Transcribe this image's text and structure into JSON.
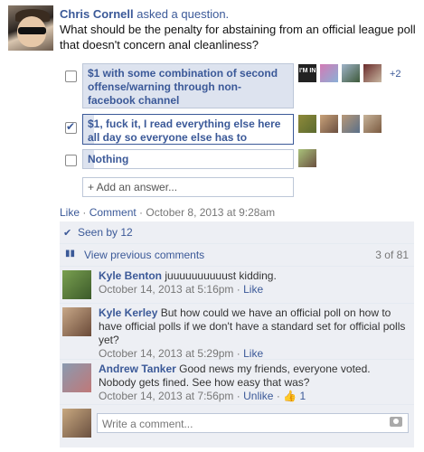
{
  "post": {
    "author": "Chris Cornell",
    "verb": "asked a question.",
    "question": "What should be the penalty for abstaining from an official league poll that doesn't concern anal cleanliness?"
  },
  "poll": {
    "options": [
      {
        "label": "$1 with some combination of second offense/warning through non-facebook channel",
        "checked": false,
        "fill": 1.0,
        "voters": [
          "avatar",
          "avatar",
          "avatar",
          "avatar"
        ],
        "more": "+2"
      },
      {
        "label": "$1, fuck it, I read everything else here all day so everyone else has to",
        "checked": true,
        "fill": 0.05,
        "voters": [
          "avatar",
          "avatar",
          "avatar",
          "avatar"
        ]
      },
      {
        "label": "Nothing",
        "checked": false,
        "fill": 0.05,
        "voters": [
          "avatar"
        ]
      }
    ],
    "add_answer": "+ Add an answer..."
  },
  "meta": {
    "like": "Like",
    "comment": "Comment",
    "date": "October 8, 2013 at 9:28am"
  },
  "ufi": {
    "seen": "Seen by 12",
    "view_previous": "View previous comments",
    "count": "3 of 81",
    "comments": [
      {
        "name": "Kyle Benton",
        "text": "juuuuuuuuuust kidding.",
        "date": "October 14, 2013 at 5:16pm",
        "action": "Like"
      },
      {
        "name": "Kyle Kerley",
        "text": "But how could we have an official poll on how to have official polls if we don't have a standard set for official polls yet?",
        "date": "October 14, 2013 at 5:29pm",
        "action": "Like"
      },
      {
        "name": "Andrew Tanker",
        "text": "Good news my friends, everyone voted. Nobody gets fined. See how easy that was?",
        "date": "October 14, 2013 at 7:56pm",
        "action": "Unlike",
        "likes": "1"
      }
    ],
    "write_placeholder": "Write a comment..."
  }
}
